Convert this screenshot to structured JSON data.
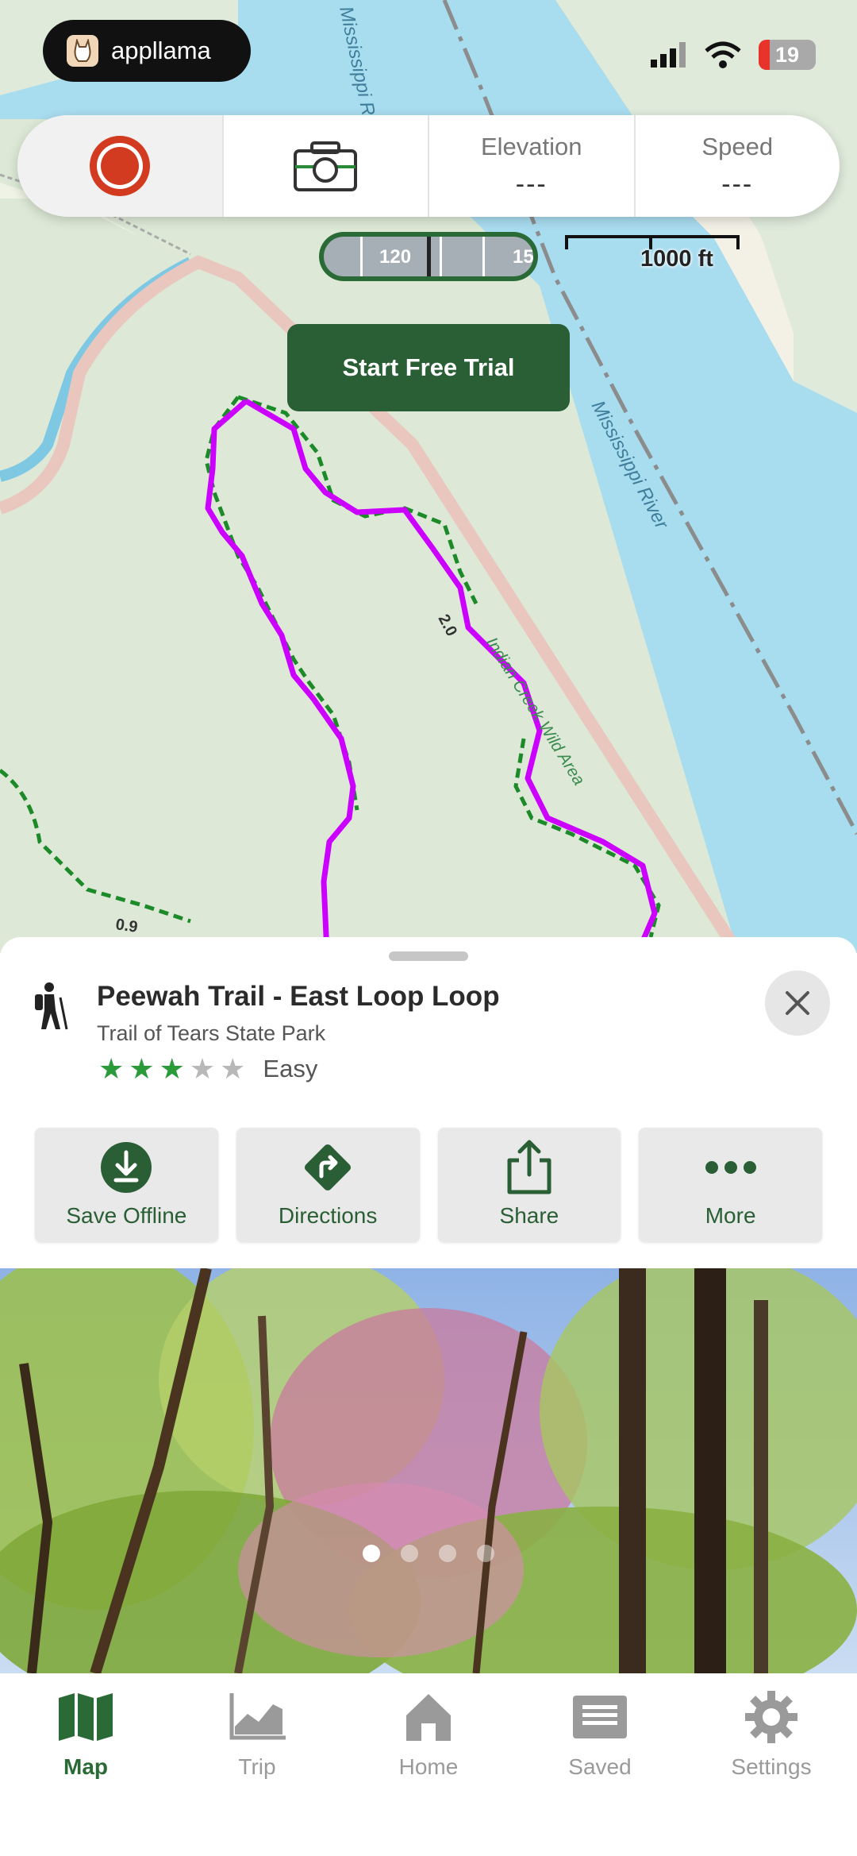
{
  "status_bar": {
    "app_name": "appllama",
    "battery": "19"
  },
  "toolbar": {
    "elevation_label": "Elevation",
    "elevation_value": "---",
    "speed_label": "Speed",
    "speed_value": "---"
  },
  "map": {
    "zoom_labels": [
      "120",
      "15"
    ],
    "scale_label": "1000 ft",
    "river_labels": [
      "Mississippi River",
      "Mississippi River"
    ],
    "area_label": "Indian Creek Wild Area",
    "mile_markers": [
      "2.0",
      "0.9"
    ],
    "trial_button": "Start Free Trial"
  },
  "trail": {
    "title": "Peewah Trail - East Loop Loop",
    "park": "Trail of Tears State Park",
    "difficulty": "Easy",
    "rating": 3,
    "rating_max": 5
  },
  "actions": {
    "save_offline": "Save Offline",
    "directions": "Directions",
    "share": "Share",
    "more": "More"
  },
  "photo": {
    "page_count": 4,
    "current_page": 1
  },
  "tabs": {
    "map": "Map",
    "trip": "Trip",
    "home": "Home",
    "saved": "Saved",
    "settings": "Settings",
    "active": "Map"
  },
  "colors": {
    "accent": "#2a5e35",
    "trail_line": "#cc00ff",
    "water": "#a8dcef",
    "land": "#dde9d6",
    "record": "#d23b1f"
  }
}
